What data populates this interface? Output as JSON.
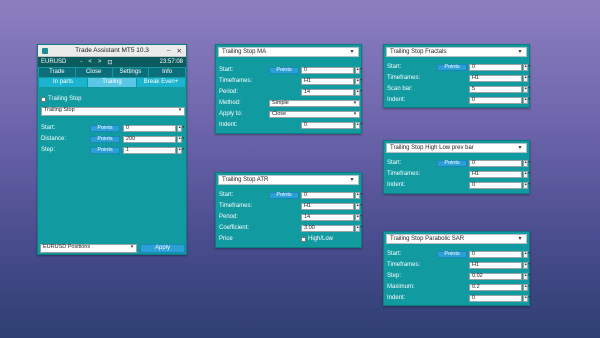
{
  "main": {
    "title": "Trade Assistant MT5 10.3",
    "symbol": "EURUSD",
    "nav": [
      "-",
      "<",
      ">",
      "⊡"
    ],
    "time": "23:57:08",
    "tabs_top": [
      "Trade",
      "Close",
      "Settings",
      "Info"
    ],
    "tabs_bottom": [
      "In parts",
      "Trailing",
      "Break Even+"
    ],
    "trailing_checkbox": "Trailing Stop",
    "mode_select": "Trailing Stop",
    "fields": [
      {
        "label": "Start:",
        "button": "Points",
        "value": "0"
      },
      {
        "label": "Distance:",
        "button": "Points",
        "value": "200"
      },
      {
        "label": "Step:",
        "button": "Points",
        "value": "1"
      }
    ],
    "positions_select": "EURUSD Positions",
    "apply_label": "Apply"
  },
  "ma": {
    "title": "Trailing Stop MA",
    "start_label": "Start:",
    "start_button": "Points",
    "start_value": "0",
    "timeframes_label": "Timeframes:",
    "timeframes_value": "H1",
    "period_label": "Period:",
    "period_value": "14",
    "method_label": "Method:",
    "method_value": "Simple",
    "apply_label": "Apply to:",
    "apply_value": "Close",
    "indent_label": "Indent:",
    "indent_value": "0"
  },
  "atr": {
    "title": "Trailing Stop ATR",
    "start_label": "Start:",
    "start_button": "Points",
    "start_value": "0",
    "timeframes_label": "Timeframes:",
    "timeframes_value": "H1",
    "period_label": "Period:",
    "period_value": "14",
    "coef_label": "Coefficient:",
    "coef_value": "3.00",
    "price_label": "Price",
    "price_check": "High/Low"
  },
  "fractals": {
    "title": "Trailing Stop Fractals",
    "start_label": "Start:",
    "start_button": "Points",
    "start_value": "0",
    "timeframes_label": "Timeframes:",
    "timeframes_value": "H1",
    "scan_label": "Scan bar:",
    "scan_value": "5",
    "indent_label": "Indent:",
    "indent_value": "0"
  },
  "highlow": {
    "title": "Trailing Stop High Low prev bar",
    "start_label": "Start:",
    "start_button": "Points",
    "start_value": "0",
    "timeframes_label": "Timeframes:",
    "timeframes_value": "H1",
    "indent_label": "Indent:",
    "indent_value": "0"
  },
  "sar": {
    "title": "Trailing Stop Parabolic SAR",
    "start_label": "Start:",
    "start_button": "Points",
    "start_value": "0",
    "timeframes_label": "Timeframes:",
    "timeframes_value": "H1",
    "step_label": "Step:",
    "step_value": "0.02",
    "max_label": "Maximum:",
    "max_value": "0.2",
    "indent_label": "Indent:",
    "indent_value": "0"
  }
}
